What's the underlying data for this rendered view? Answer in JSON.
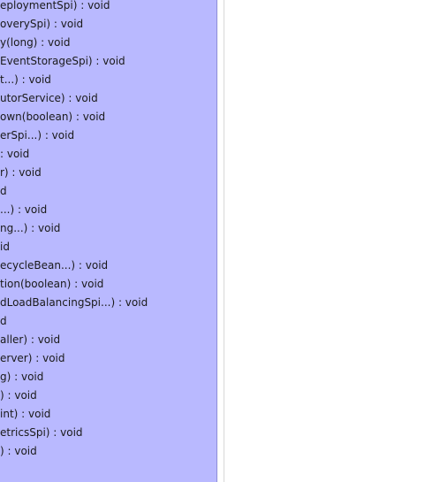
{
  "colors": {
    "panel_background": "#b9b9ff",
    "panel_border": "#8e8ed8",
    "text": "#1a1a1a",
    "background": "#ffffff"
  },
  "methods": [
    "eploymentSpi) : void",
    "overySpi) : void",
    "y(long) : void",
    "EventStorageSpi) : void",
    "t...) : void",
    "utorService) : void",
    "own(boolean) : void",
    "erSpi...) : void",
    ": void",
    "r) : void",
    "d",
    "...) : void",
    "ng...) : void",
    "id",
    "ecycleBean...) : void",
    "tion(boolean) : void",
    "dLoadBalancingSpi...) : void",
    "d",
    "aller) : void",
    "erver) : void",
    "g) : void",
    ") : void",
    "int) : void",
    "etricsSpi) : void",
    ") : void"
  ]
}
